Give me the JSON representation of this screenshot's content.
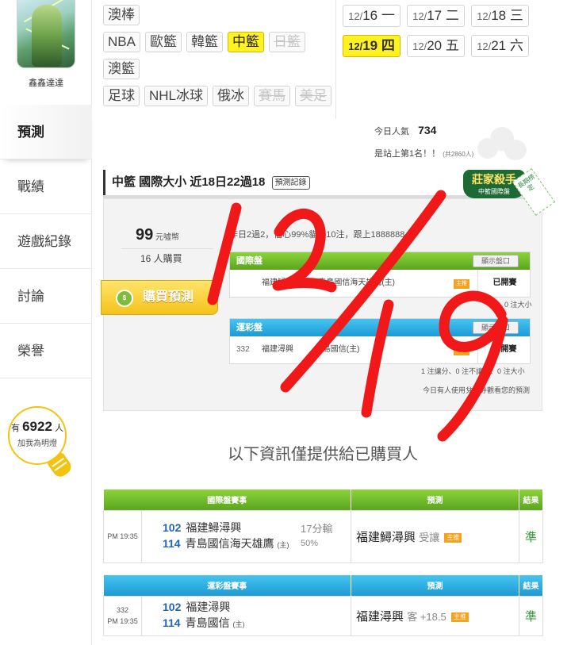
{
  "user": {
    "name": "鑫鑫達達"
  },
  "nav": {
    "items": [
      {
        "label": "預測",
        "active": true
      },
      {
        "label": "戰績"
      },
      {
        "label": "遊戲紀錄"
      },
      {
        "label": "討論"
      },
      {
        "label": "榮譽"
      }
    ]
  },
  "bulb": {
    "prefix": "有",
    "count": "6922",
    "suffix": "人",
    "sub": "加我為明燈"
  },
  "sports": {
    "rows": [
      [
        {
          "label": "澳棒"
        }
      ],
      [
        {
          "label": "NBA"
        },
        {
          "label": "歐籃"
        },
        {
          "label": "韓籃"
        },
        {
          "label": "中籃",
          "state": "active"
        },
        {
          "label": "日籃",
          "state": "disabled"
        }
      ],
      [
        {
          "label": "澳籃"
        }
      ],
      [
        {
          "label": "足球"
        },
        {
          "label": "NHL冰球"
        },
        {
          "label": "俄冰"
        },
        {
          "label": "賽馬",
          "state": "disabled"
        },
        {
          "label": "美足",
          "state": "disabled"
        }
      ]
    ]
  },
  "dates": {
    "row1": [
      {
        "m": "12/",
        "d": "16",
        "w": "一"
      },
      {
        "m": "12/",
        "d": "17",
        "w": "二"
      },
      {
        "m": "12/",
        "d": "18",
        "w": "三"
      }
    ],
    "row2": [
      {
        "m": "12/",
        "d": "19",
        "w": "四",
        "active": true
      },
      {
        "m": "12/",
        "d": "20",
        "w": "五"
      },
      {
        "m": "12/",
        "d": "21",
        "w": "六"
      }
    ]
  },
  "popularity": {
    "label": "今日人氣",
    "value": "734",
    "rank": "是站上第1名！！",
    "note": "(共2860人)"
  },
  "card": {
    "title": "中籃 國際大小 近18日22過18",
    "record_btn": "預測記錄",
    "badge_main": "莊家殺手",
    "badge_sub": "中籃國際盤",
    "badge_ribbon": "長期榜定",
    "price_value": "99",
    "price_unit": "元噓幣",
    "buyers": "16 人購買",
    "buy_label": "購買預測",
    "coin": "$",
    "summary": "昨日2過2，信心99%貓場10注，跟上1888888",
    "intl": {
      "head": "國際盤",
      "btn": "顯示盤口",
      "away": "福建鱘潯興",
      "vs": "VS",
      "home": "青島國信海天雄鷹(主)",
      "host_tag": "主推",
      "state": "已開賽",
      "foot": "0 注大小"
    },
    "lottery": {
      "head": "運彩盤",
      "btn": "顯示盤口",
      "num": "332",
      "away": "福建潯興",
      "home": "青島國信(主)",
      "host_tag": "主推",
      "state": "已開賽",
      "foot": "1 注讓分、0 注不讓分、0 注大小",
      "foot2": "今日有人使用兌換券觀看您的預測"
    }
  },
  "info_text": "以下資訊僅提供給已購買人",
  "table_intl": {
    "headers": {
      "game": "國際盤賽事",
      "pred": "預測",
      "res": "結果"
    },
    "time": "PM 19:35",
    "away_num": "102",
    "away": "福建鱘潯興",
    "home_num": "114",
    "home": "青島國信海天雄鷹",
    "host": "(主)",
    "score": "17分輸",
    "score_pct": "50%",
    "pred_team": "福建鱘潯興",
    "pred_sub": "受讓",
    "pred_tag": "主推",
    "result": "準"
  },
  "table_lottery": {
    "headers": {
      "game": "運彩盤賽事",
      "pred": "預測",
      "res": "結果"
    },
    "num": "332",
    "time": "PM 19:35",
    "away_num": "102",
    "away": "福建潯興",
    "home_num": "114",
    "home": "青島國信",
    "host": "(主)",
    "pred_team": "福建潯興",
    "pred_sub": "客 +18.5",
    "pred_tag": "主推",
    "result": "準"
  },
  "overlay_text": "12/19",
  "colors": {
    "accent_yellow": "#fff222",
    "green": "#5aa51e",
    "blue": "#1e9ad6",
    "overlay_red": "#f01818"
  }
}
